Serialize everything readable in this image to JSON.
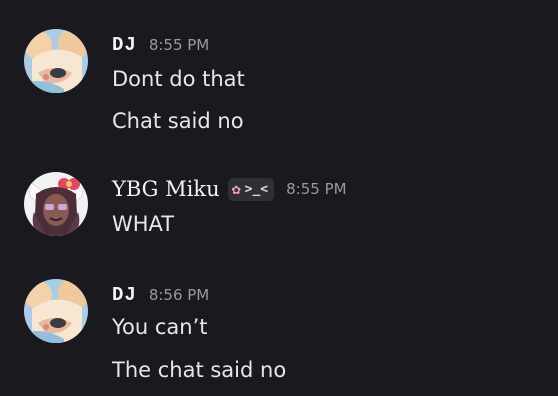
{
  "messages": [
    {
      "author": "DJ",
      "timestamp": "8:55 PM",
      "lines": [
        "Dont do that",
        "Chat said no"
      ]
    },
    {
      "author": "YBG Miku",
      "tag": ">_<",
      "tag_icon": "cherry-blossom-icon",
      "timestamp": "8:55 PM",
      "lines": [
        "WHAT"
      ]
    },
    {
      "author": "DJ",
      "timestamp": "8:56 PM",
      "lines": [
        "You can’t",
        "The chat said no"
      ]
    }
  ],
  "colors": {
    "background": "#1a1a1e",
    "username": "#f2f3f5",
    "timestamp": "#949ba4",
    "text": "#e6e7ea",
    "tag_bg": "#2e3036"
  }
}
